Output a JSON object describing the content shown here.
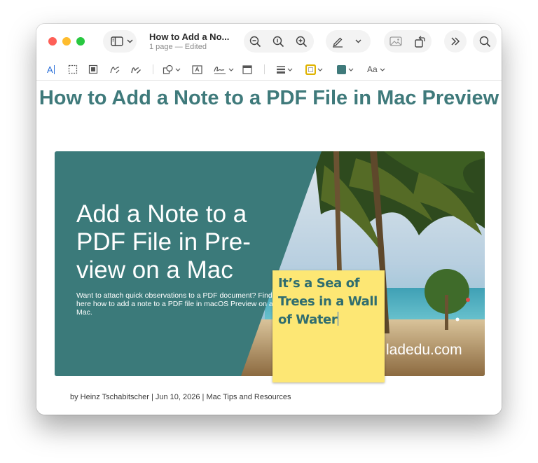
{
  "window": {
    "document_title": "How to Add a No...",
    "document_subtitle": "1 page — Edited"
  },
  "toolbar": {
    "icons": [
      "sidebar-icon",
      "zoom-out-icon",
      "actual-size-icon",
      "zoom-in-icon",
      "markup-pen-icon",
      "photo-icon",
      "rotate-icon",
      "more-icon",
      "search-icon"
    ]
  },
  "markup_toolbar": {
    "text_selection_label": "A",
    "font_label": "Aa",
    "colors": {
      "accent": "#2a6fd8",
      "border_color": "#e0b300",
      "fill_color": "#3f7a7b"
    }
  },
  "page": {
    "article_title": "How to Add a Note to a PDF File in Mac Preview",
    "hero": {
      "heading": "Add a Note to a PDF File in Pre-view on a Mac",
      "description": "Want to attach quick observations to a PDF document? Find out here how to add a note to a PDF file in macOS Preview on a Mac.",
      "watermark": "ladedu.com"
    },
    "note": {
      "text": "It’s a Sea of Trees in a Wall of Water",
      "background": "#fde774"
    },
    "byline": "by Heinz Tschabitscher | Jun 10, 2026 | Mac Tips and Resources"
  }
}
